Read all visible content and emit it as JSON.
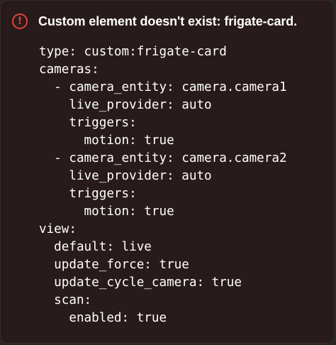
{
  "error": {
    "icon": "alert-circle-icon",
    "title": "Custom element doesn't exist: frigate-card."
  },
  "yaml_lines": [
    "type: custom:frigate-card",
    "cameras:",
    "  - camera_entity: camera.camera1",
    "    live_provider: auto",
    "    triggers:",
    "      motion: true",
    "  - camera_entity: camera.camera2",
    "    live_provider: auto",
    "    triggers:",
    "      motion: true",
    "view:",
    "  default: live",
    "  update_force: true",
    "  update_cycle_camera: true",
    "  scan:",
    "    enabled: true"
  ],
  "colors": {
    "background": "#281b1b",
    "error_accent": "#e0423f",
    "text": "#ffffff"
  }
}
